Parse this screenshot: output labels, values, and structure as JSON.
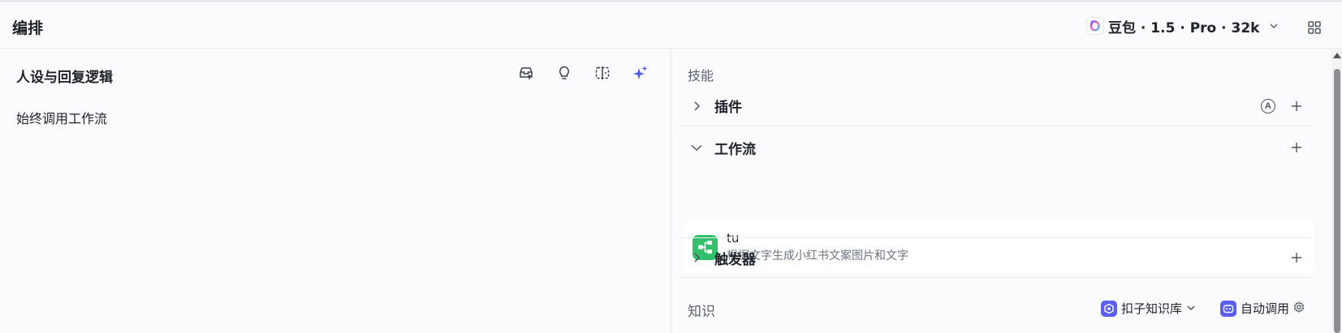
{
  "header": {
    "title": "编排",
    "model_name": "豆包 · 1.5 · Pro · 32k"
  },
  "left": {
    "title": "人设与回复逻辑",
    "prompt_text": "始终调用工作流"
  },
  "right": {
    "skills_label": "技能",
    "plugins_label": "插件",
    "plugins_auto_badge": "A",
    "workflow_label": "工作流",
    "workflow_item": {
      "name": "tu",
      "description": "根据文字生成小红书文案图片和文字"
    },
    "triggers_label": "触发器",
    "knowledge_label": "知识",
    "kb_source": "扣子知识库",
    "kb_mode": "自动调用"
  },
  "colors": {
    "accent": "#5b5ff0",
    "workflow_icon": "#34c06b",
    "sparkle": "#4f56f2"
  }
}
